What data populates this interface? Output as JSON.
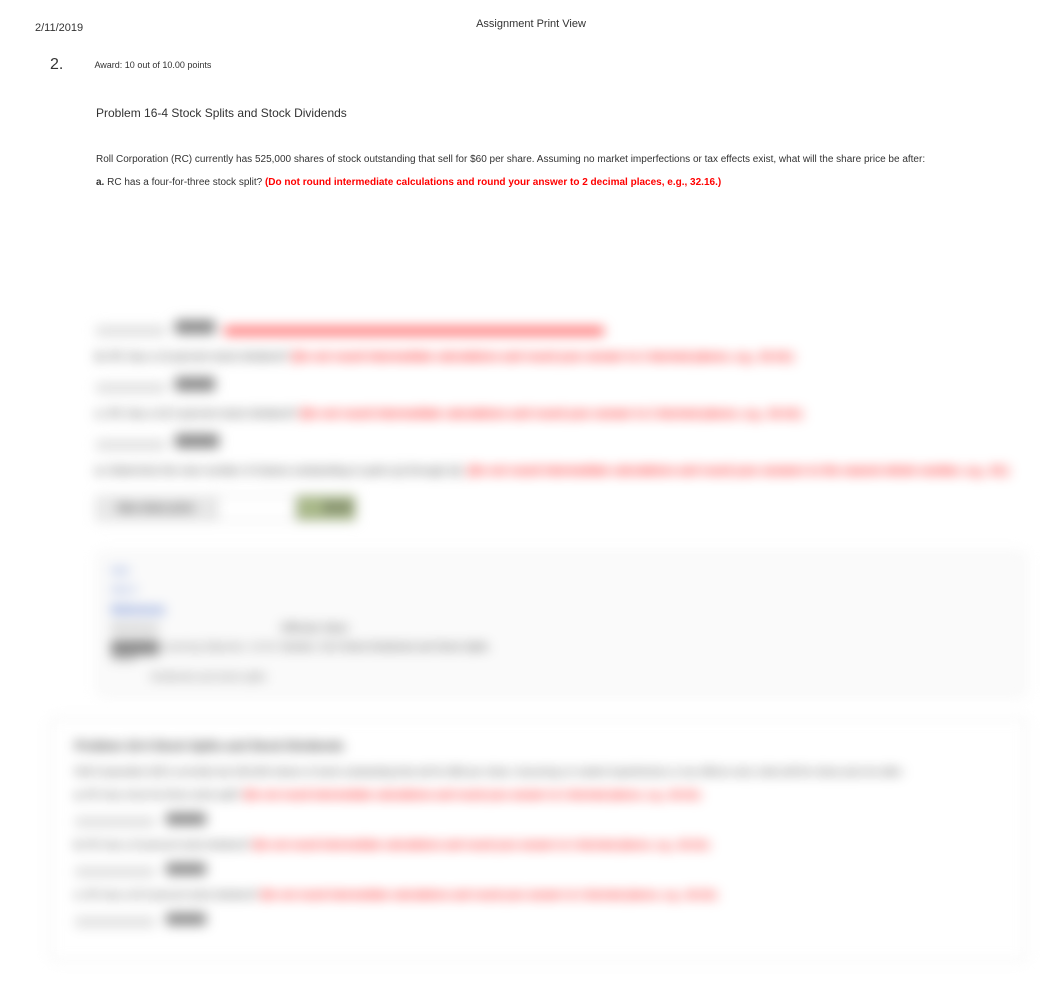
{
  "header": {
    "date": "2/11/2019",
    "title": "Assignment Print View"
  },
  "question": {
    "number": "2.",
    "award": "Award: 10 out of 10.00 points",
    "problem_title": "Problem 16-4 Stock Splits and Stock Dividends",
    "stem": "Roll Corporation (RC) currently has 525,000 shares of stock outstanding that sell for $60 per share. Assuming no market imperfections or tax effects exist, what will the share price be after:",
    "parts": {
      "a": {
        "label": "a.",
        "text": " RC has a four-for-three stock split? ",
        "instr": "(Do not round intermediate calculations and round your answer to 2 decimal places, e.g., 32.16.)"
      }
    }
  },
  "hidden": {
    "new_price_label": "New share price",
    "answer_display": "45.00",
    "part_b_label": "b.",
    "part_b_text": " RC has a 10 percent stock dividend? ",
    "part_b_instr": "(Do not round intermediate calculations and round your answer to 2 decimal places, e.g., 32.16.)",
    "part_c_label": "c.",
    "part_c_text": " RC has a 42.5 percent stock dividend? ",
    "part_c_instr": "(Do not round intermediate calculations and round your answer to 2 decimal places, e.g., 32.16.)",
    "part_d_label": "d.",
    "part_d_text": " RC has a three-for-seven reverse stock split? ",
    "part_d_instr": "(Do not round intermediate calculations and round your answer to 2 decimal places, e.g., 32.16.)",
    "part_e_label": "e.",
    "part_e_long": " Determine the new number of shares outstanding in parts (a) through (d). ",
    "part_e_instr": "(Do not round intermediate calculations and round your answers to the nearest whole number, e.g., 32.)",
    "tabs": {
      "t1": "Hint",
      "t2": "Hint 2",
      "references": "References",
      "worksheet": "Worksheet",
      "difficulty": "Difficulty: Basic",
      "lo_line1": "Learning Objective: 16-03 Stock",
      "lo_line2": "Dividends and stock splits",
      "src": "Section: 16.6 Stock Dividends and Stock Splits"
    },
    "explanation": {
      "title": "Problem 16-4 Stock Splits and Stock Dividends",
      "line1": "Roll Corporation (RC) currently has 525,000 shares of stock outstanding that sell for $60 per share. Assuming no market imperfections or tax effects exist, what will the share price be after:",
      "exp_a_label": "a.",
      "exp_a_text": " RC has a four-for-three stock split? ",
      "exp_a_instr": "(Do not round intermediate calculations and round your answer to 2 decimal places, e.g., 32.16.)",
      "new_price_a": "New share price",
      "val_a": "45.00",
      "exp_b_label": "b.",
      "exp_b_text": " RC has a 10 percent stock dividend? ",
      "exp_b_instr": "(Do not round intermediate calculations and round your answer to 2 decimal places, e.g., 32.16.)",
      "new_price_b": "New share price",
      "val_b": "54.55",
      "exp_c_label": "c.",
      "exp_c_text": " RC has a 42.5 percent stock dividend? ",
      "exp_c_instr": "(Do not round intermediate calculations and round your answer to 2 decimal places, e.g., 32.16.)",
      "new_price_c": "New share price",
      "val_c": "42.11"
    }
  }
}
